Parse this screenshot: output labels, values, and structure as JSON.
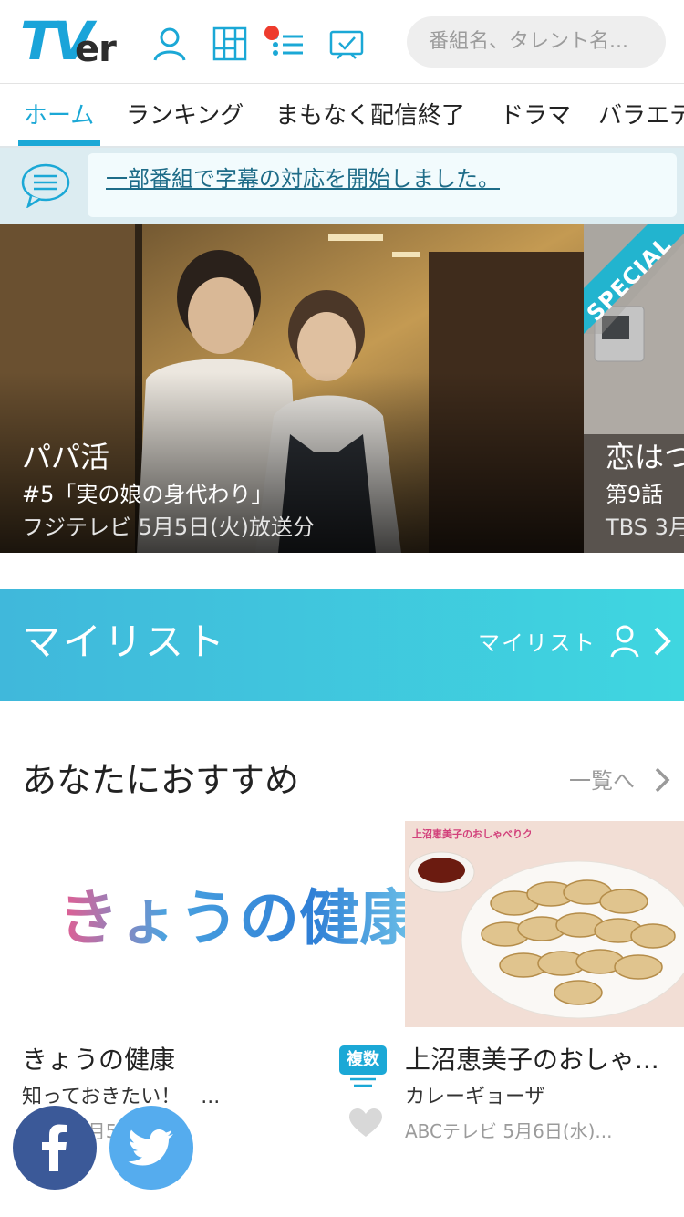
{
  "header": {
    "logo_tv": "TV",
    "logo_er": "er",
    "search_placeholder": "番組名、タレント名..."
  },
  "tabs": [
    {
      "label": "ホーム",
      "active": true
    },
    {
      "label": "ランキング"
    },
    {
      "label": "まもなく配信終了"
    },
    {
      "label": "ドラマ"
    },
    {
      "label": "バラエテ"
    }
  ],
  "notice": {
    "text": "一部番組で字幕の対応を開始しました。"
  },
  "carousel": {
    "main": {
      "title": "パパ活",
      "episode": "#5「実の娘の身代わり」",
      "meta": "フジテレビ 5月5日(火)放送分"
    },
    "next": {
      "title": "恋はつ",
      "episode": "第9話",
      "meta": "TBS 3月",
      "ribbon": "SPECIAL"
    }
  },
  "mylist": {
    "title": "マイリスト",
    "link_label": "マイリスト"
  },
  "recommend": {
    "title": "あなたにおすすめ",
    "more_label": "一覧へ",
    "cards": [
      {
        "image_text": "きょうの健康",
        "title": "きょうの健康",
        "subtitle": "知っておきたい！　...",
        "meta": "Eテレ 5月5...",
        "badge": "複数"
      },
      {
        "image_text": "上沼恵美子のおしゃべりクッキング",
        "title": "上沼恵美子のおしゃ...",
        "subtitle": "カレーギョーザ",
        "meta": "ABCテレビ 5月6日(水)..."
      }
    ]
  },
  "share": {
    "facebook_color": "#3b5998",
    "twitter_color": "#55acee"
  },
  "colors": {
    "accent": "#1ba8d6",
    "notice_bg": "#dcecf1",
    "mylist_gradient_start": "#40b8db",
    "mylist_gradient_end": "#3fd6e0"
  }
}
